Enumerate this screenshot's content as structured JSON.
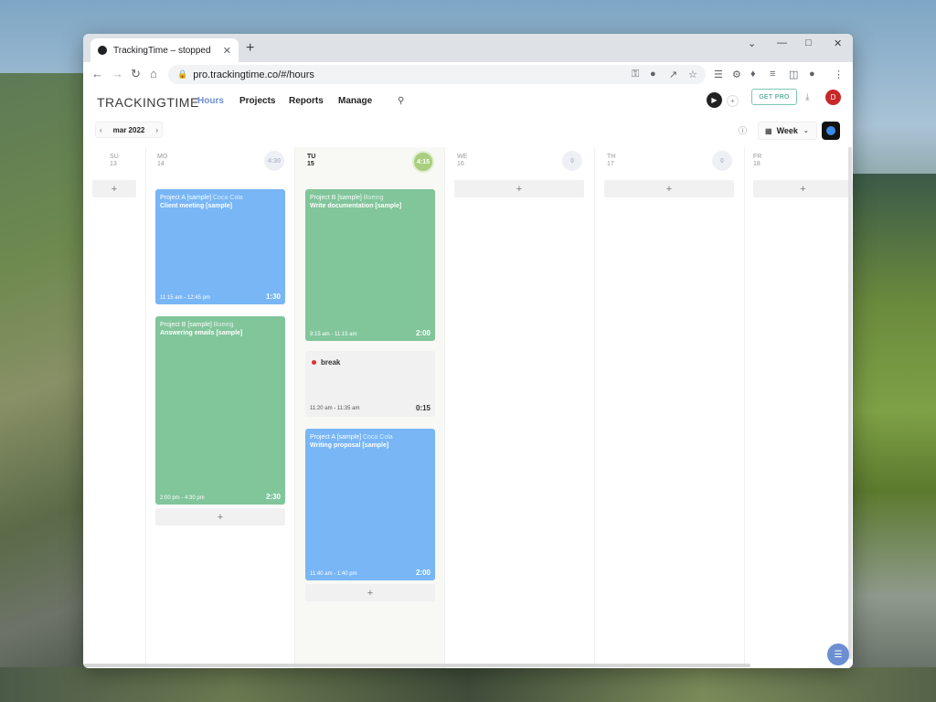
{
  "browser": {
    "tab_title": "TrackingTime – stopped",
    "tab_close": "✕",
    "new_tab": "+",
    "url": "pro.trackingtime.co/#/hours"
  },
  "app": {
    "logo_a": "TRACKING",
    "logo_b": "TIME",
    "nav": [
      "Hours",
      "Projects",
      "Reports",
      "Manage"
    ],
    "active_nav": "Hours",
    "get_pro": "GET PRO",
    "avatar_initial": "D"
  },
  "toolbar": {
    "month": "mar 2022",
    "prev": "‹",
    "next": "›",
    "view": "Week"
  },
  "days": [
    {
      "abbr": "SU",
      "num": "13",
      "badge": ""
    },
    {
      "abbr": "MO",
      "num": "14",
      "badge": "4:30"
    },
    {
      "abbr": "TU",
      "num": "15",
      "badge": "4:15"
    },
    {
      "abbr": "WE",
      "num": "16",
      "badge": "0"
    },
    {
      "abbr": "TH",
      "num": "17",
      "badge": "0"
    },
    {
      "abbr": "FR",
      "num": "18",
      "badge": ""
    }
  ],
  "add_label": "+",
  "events": [
    {
      "project": "Project A [sample]",
      "client": "Coca Cola",
      "name": "Client meeting [sample]",
      "time": "11:15 am - 12:45 pm",
      "duration": "1:30",
      "color": "#78b6f6"
    },
    {
      "project": "Project B [sample]",
      "client": "Boeing",
      "name": "Answering emails [sample]",
      "time": "2:00 pm - 4:30 pm",
      "duration": "2:30",
      "color": "#81c59b"
    },
    {
      "project": "Project B [sample]",
      "client": "Boeing",
      "name": "Write documentation [sample]",
      "time": "9:15 am - 11:15 am",
      "duration": "2:00",
      "color": "#81c59b"
    },
    {
      "project": "Project A [sample]",
      "client": "Coca Cola",
      "name": "Writing proposal [sample]",
      "time": "11:40 am - 1:40 pm",
      "duration": "2:00",
      "color": "#78b6f6"
    }
  ],
  "break": {
    "name": "break",
    "time": "11:20 am - 11:35 am",
    "duration": "0:15"
  }
}
